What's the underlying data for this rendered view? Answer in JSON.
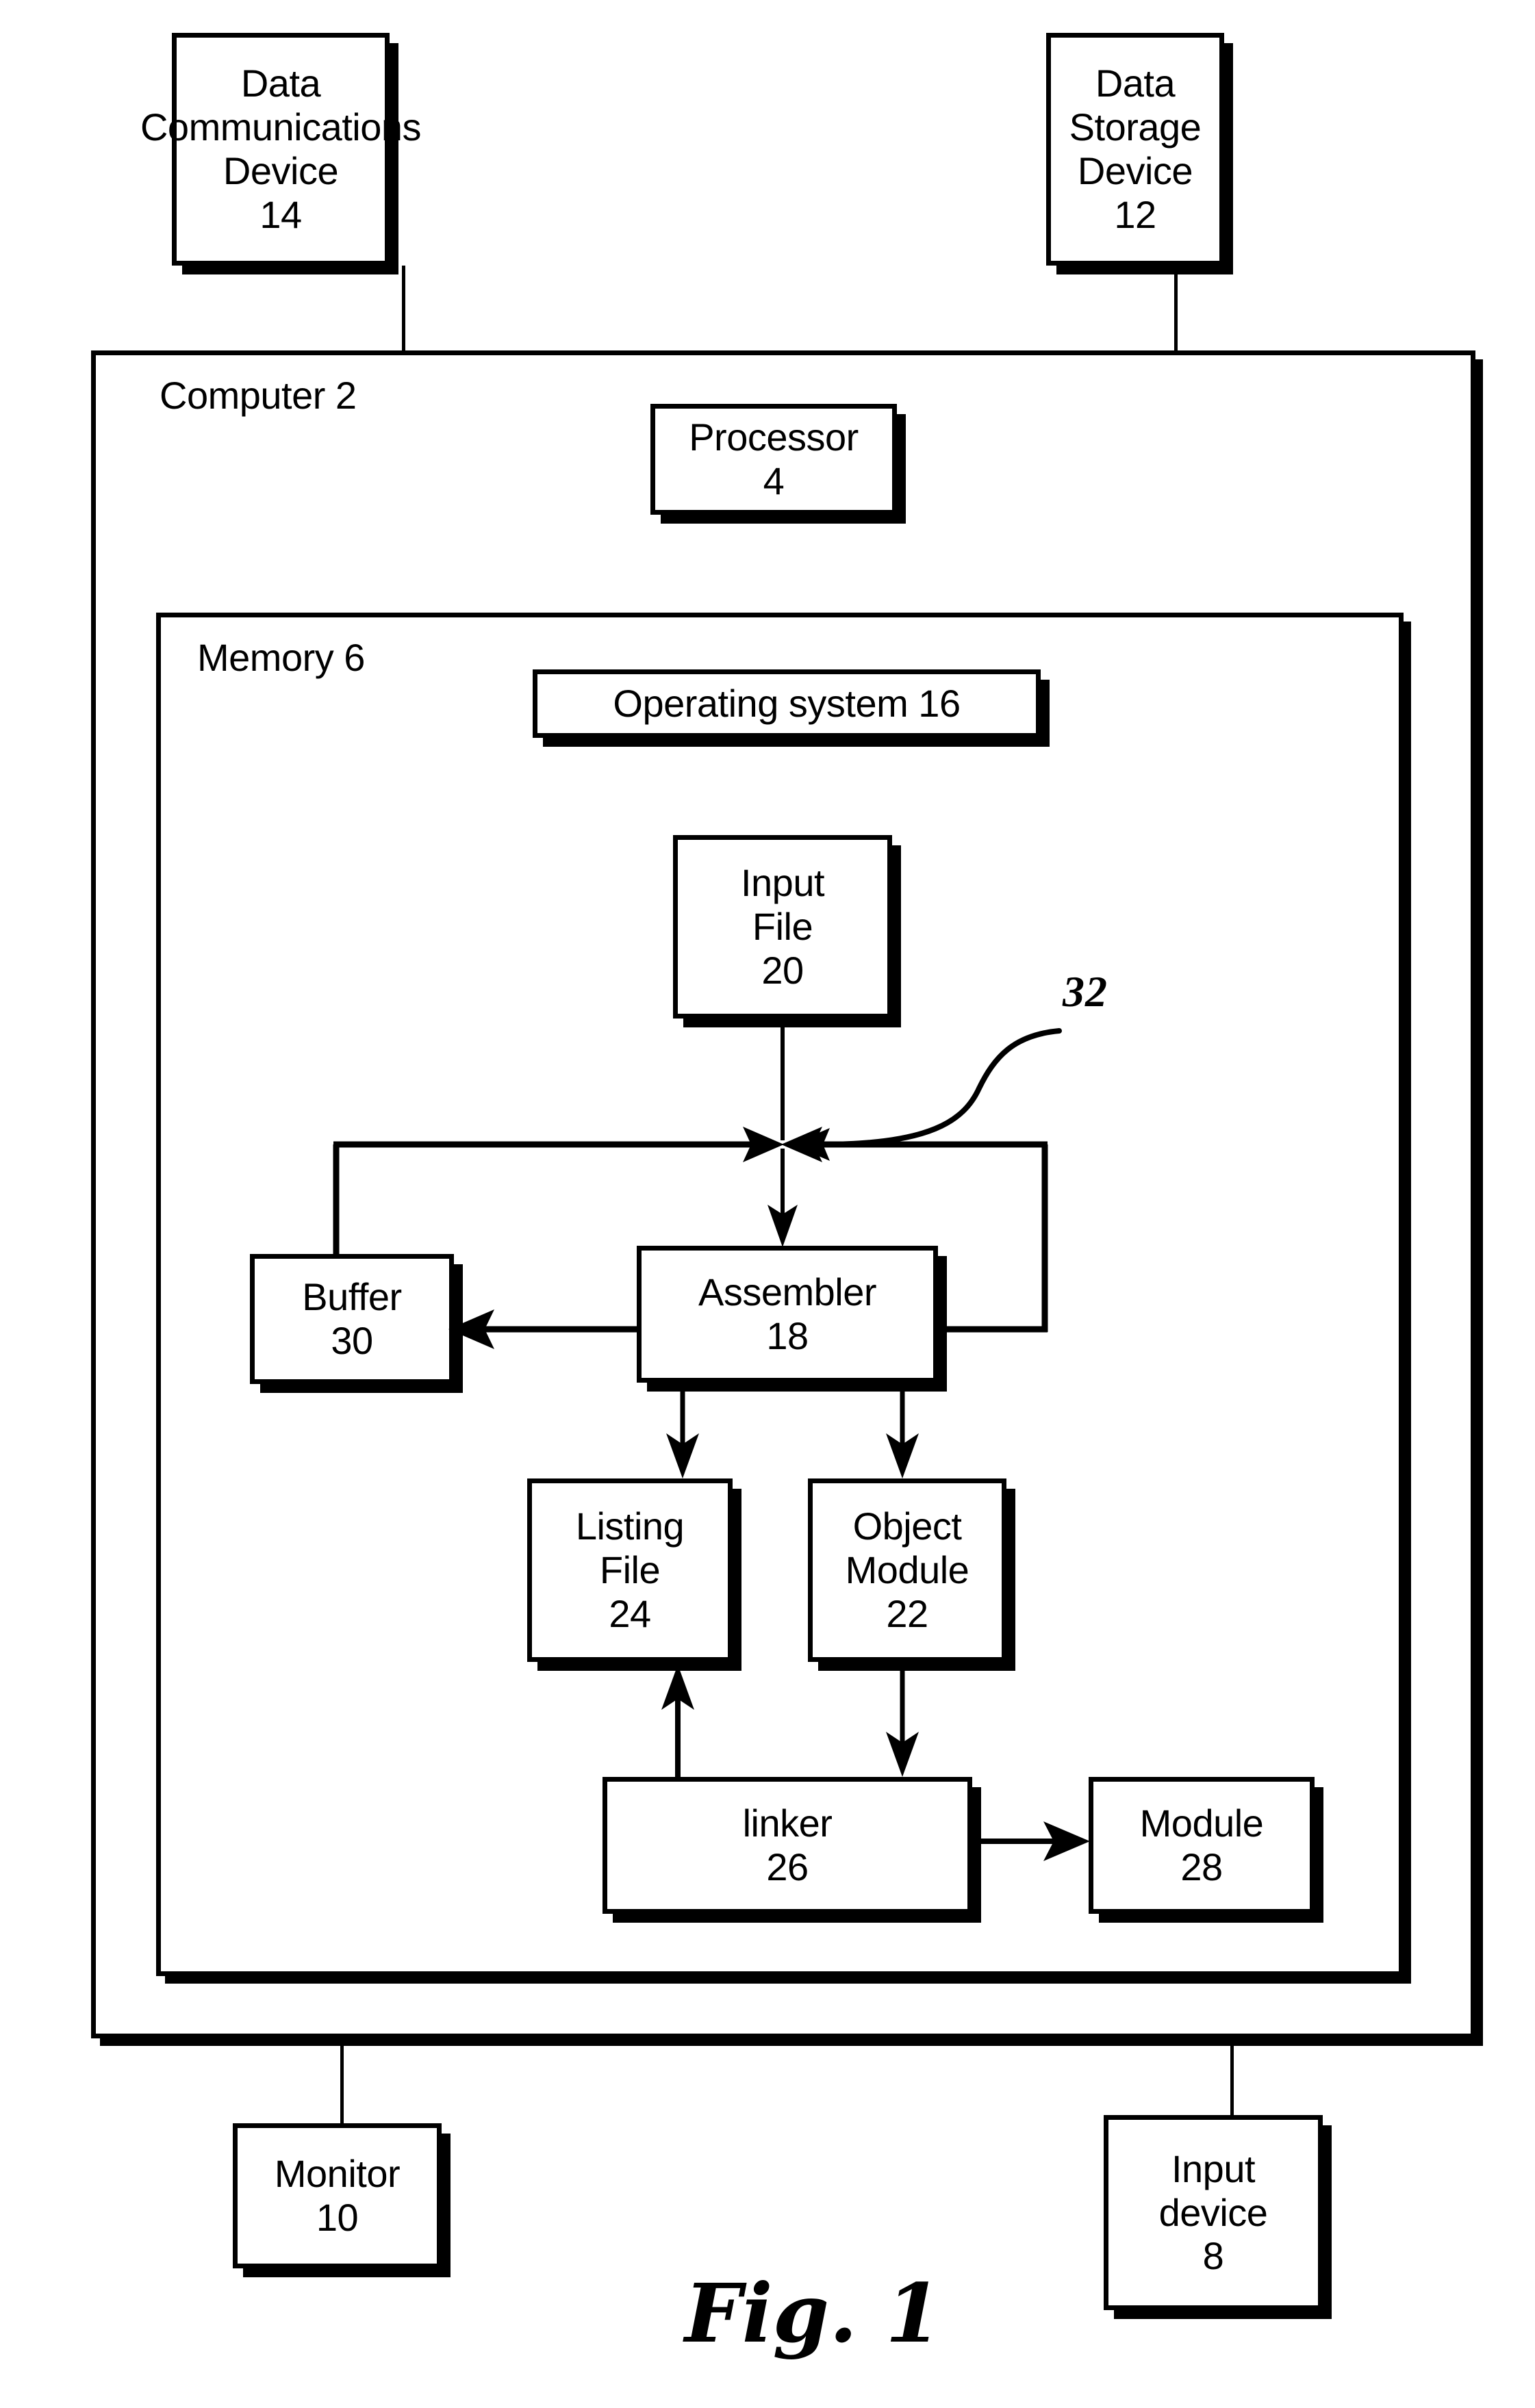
{
  "figure": {
    "caption": "Fig. 1",
    "callout_32": "32"
  },
  "containers": {
    "computer": {
      "label": "Computer 2"
    },
    "memory": {
      "label": "Memory 6"
    }
  },
  "nodes": {
    "data_communications_device": {
      "text": "Data\nCommunications\nDevice\n14"
    },
    "data_storage_device": {
      "text": "Data\nStorage\nDevice\n12"
    },
    "processor": {
      "text": "Processor\n4"
    },
    "operating_system": {
      "text": "Operating system 16"
    },
    "input_file": {
      "text": "Input\nFile\n20"
    },
    "buffer": {
      "text": "Buffer\n30"
    },
    "assembler": {
      "text": "Assembler\n18"
    },
    "listing_file": {
      "text": "Listing\nFile\n24"
    },
    "object_module": {
      "text": "Object\nModule\n22"
    },
    "linker": {
      "text": "linker\n26"
    },
    "module": {
      "text": "Module\n28"
    },
    "monitor": {
      "text": "Monitor\n10"
    },
    "input_device": {
      "text": "Input\ndevice\n8"
    }
  },
  "colors": {
    "ink": "#000000",
    "paper": "#ffffff"
  }
}
